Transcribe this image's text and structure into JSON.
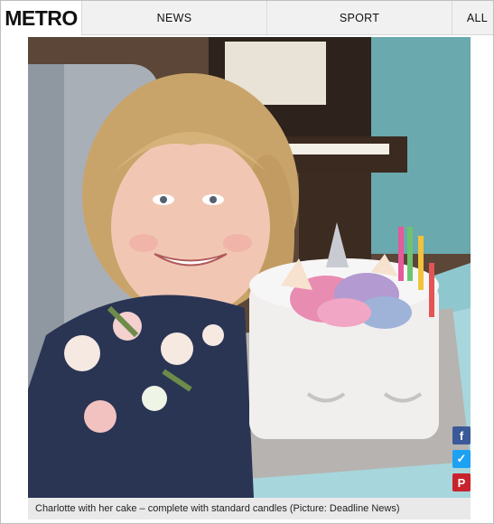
{
  "nav": {
    "logo": "METRO",
    "items": [
      {
        "label": "NEWS"
      },
      {
        "label": "SPORT"
      },
      {
        "label": "ALL"
      }
    ]
  },
  "article": {
    "caption": "Charlotte with her cake – complete with standard candles (Picture: Deadline News)"
  },
  "share": {
    "buttons": [
      {
        "icon": "facebook-icon",
        "glyph": "f",
        "color": "#3b5998"
      },
      {
        "icon": "twitter-icon",
        "glyph": "✓",
        "color": "#1da1f2"
      },
      {
        "icon": "pinterest-icon",
        "glyph": "P",
        "color": "#c8232c"
      }
    ]
  }
}
